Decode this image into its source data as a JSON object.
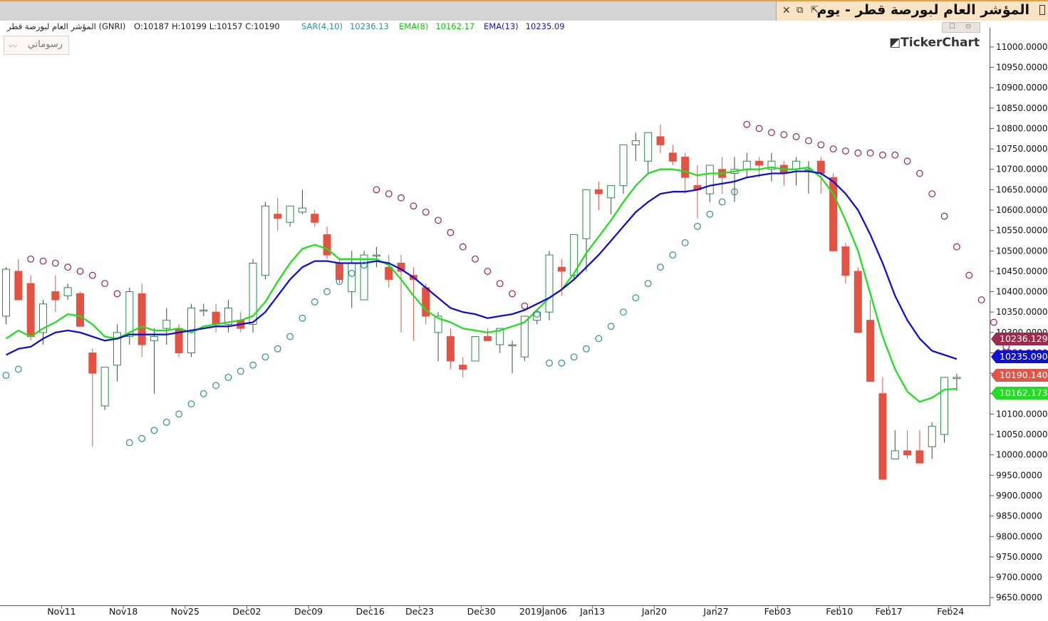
{
  "window": {
    "title": "المؤشر العام لبورصة قطر - يوم",
    "close_icon": "close-icon",
    "restore_icon": "restore-icon",
    "detach_icon": "detach-icon"
  },
  "header": {
    "symbol": "المؤشر العام لبورصة قطر (GNRI)",
    "ohlc": "O:10187  H:10199  L:10157  C:10190",
    "indicators": [
      {
        "label": "SAR(4,10)",
        "value": "10236.13",
        "color": "#2a8f9a"
      },
      {
        "label": "EMA(8)",
        "value": "10162.17",
        "color": "#00e000"
      },
      {
        "label": "EMA(13)",
        "value": "10235.09",
        "color": "#1515c8"
      }
    ]
  },
  "toolbar": {
    "drawing_label": "رسوماتي",
    "drawing_icon": "line-chart-icon"
  },
  "watermark": "TickerChart",
  "chart_data": {
    "type": "candlestick",
    "ylim": [
      9630,
      11020
    ],
    "y_ticks": [
      11000,
      10950,
      10900,
      10850,
      10800,
      10750,
      10700,
      10650,
      10600,
      10550,
      10500,
      10450,
      10400,
      10350,
      10300,
      10250,
      10200,
      10150,
      10100,
      10050,
      10000,
      9950,
      9900,
      9850,
      9800,
      9750,
      9700,
      9650
    ],
    "y_tick_labels": [
      "11000.0000",
      "10950.0000",
      "10900.0000",
      "10850.0000",
      "10800.0000",
      "10750.0000",
      "10700.0000",
      "10650.0000",
      "10600.0000",
      "10550.0000",
      "10500.0000",
      "10450.0000",
      "10400.0000",
      "10350.0000",
      "10300.0000",
      "10250.0000",
      "10200.0000",
      "10150.0000",
      "10100.0000",
      "10050.0000",
      "10000.0000",
      "9950.0000",
      "9900.0000",
      "9850.0000",
      "9800.0000",
      "9750.0000",
      "9700.0000",
      "9650.0000"
    ],
    "x_labels": [
      {
        "label": "Nov11",
        "index": 4.5
      },
      {
        "label": "Nov18",
        "index": 9.5
      },
      {
        "label": "Nov25",
        "index": 14.5
      },
      {
        "label": "Dec02",
        "index": 19.5
      },
      {
        "label": "Dec09",
        "index": 24.5
      },
      {
        "label": "Dec16",
        "index": 29.5
      },
      {
        "label": "Dec23",
        "index": 33.5
      },
      {
        "label": "Dec30",
        "index": 38.5
      },
      {
        "label": "2019Jan06",
        "index": 43.5
      },
      {
        "label": "Jan13",
        "index": 47.5
      },
      {
        "label": "Jan20",
        "index": 52.5
      },
      {
        "label": "Jan27",
        "index": 57.5
      },
      {
        "label": "Feb03",
        "index": 62.5
      },
      {
        "label": "Feb10",
        "index": 67.5
      },
      {
        "label": "Feb17",
        "index": 71.5
      },
      {
        "label": "Feb24",
        "index": 76.5
      }
    ],
    "candles": [
      [
        10340,
        10460,
        10320,
        10455
      ],
      [
        10450,
        10480,
        10400,
        10380
      ],
      [
        10420,
        10440,
        10280,
        10290
      ],
      [
        10300,
        10380,
        10270,
        10370
      ],
      [
        10400,
        10440,
        10350,
        10380
      ],
      [
        10390,
        10420,
        10380,
        10410
      ],
      [
        10395,
        10400,
        10320,
        10315
      ],
      [
        10250,
        10260,
        10020,
        10200
      ],
      [
        10120,
        10210,
        10110,
        10215
      ],
      [
        10220,
        10320,
        10180,
        10300
      ],
      [
        10290,
        10410,
        10270,
        10400
      ],
      [
        10395,
        10420,
        10240,
        10270
      ],
      [
        10280,
        10310,
        10150,
        10290
      ],
      [
        10310,
        10360,
        10270,
        10330
      ],
      [
        10310,
        10320,
        10240,
        10250
      ],
      [
        10250,
        10370,
        10240,
        10360
      ],
      [
        10355,
        10370,
        10340,
        10355
      ],
      [
        10350,
        10370,
        10300,
        10320
      ],
      [
        10320,
        10380,
        10300,
        10360
      ],
      [
        10330,
        10350,
        10300,
        10310
      ],
      [
        10320,
        10480,
        10300,
        10470
      ],
      [
        10440,
        10620,
        10430,
        10610
      ],
      [
        10590,
        10630,
        10550,
        10580
      ],
      [
        10570,
        10610,
        10560,
        10610
      ],
      [
        10595,
        10650,
        10590,
        10605
      ],
      [
        10590,
        10600,
        10560,
        10570
      ],
      [
        10540,
        10560,
        10480,
        10490
      ],
      [
        10470,
        10480,
        10420,
        10430
      ],
      [
        10400,
        10500,
        10360,
        10470
      ],
      [
        10380,
        10500,
        10380,
        10490
      ],
      [
        10490,
        10510,
        10460,
        10490
      ],
      [
        10460,
        10490,
        10410,
        10430
      ],
      [
        10470,
        10490,
        10300,
        10450
      ],
      [
        10440,
        10460,
        10280,
        10430
      ],
      [
        10410,
        10420,
        10320,
        10340
      ],
      [
        10300,
        10350,
        10230,
        10340
      ],
      [
        10290,
        10310,
        10210,
        10230
      ],
      [
        10220,
        10240,
        10190,
        10210
      ],
      [
        10230,
        10290,
        10230,
        10290
      ],
      [
        10290,
        10310,
        10280,
        10280
      ],
      [
        10270,
        10310,
        10250,
        10310
      ],
      [
        10270,
        10280,
        10200,
        10270
      ],
      [
        10240,
        10340,
        10230,
        10340
      ],
      [
        10330,
        10350,
        10320,
        10350
      ],
      [
        10350,
        10500,
        10330,
        10490
      ],
      [
        10460,
        10480,
        10390,
        10450
      ],
      [
        10440,
        10530,
        10430,
        10540
      ],
      [
        10530,
        10560,
        10450,
        10650
      ],
      [
        10650,
        10670,
        10600,
        10640
      ],
      [
        10630,
        10650,
        10590,
        10660
      ],
      [
        10660,
        10700,
        10640,
        10760
      ],
      [
        10760,
        10790,
        10720,
        10770
      ],
      [
        10720,
        10790,
        10690,
        10790
      ],
      [
        10780,
        10810,
        10740,
        10760
      ],
      [
        10740,
        10760,
        10710,
        10720
      ],
      [
        10730,
        10740,
        10640,
        10680
      ],
      [
        10660,
        10710,
        10580,
        10650
      ],
      [
        10640,
        10710,
        10620,
        10710
      ],
      [
        10700,
        10730,
        10640,
        10680
      ],
      [
        10690,
        10730,
        10620,
        10700
      ],
      [
        10700,
        10740,
        10680,
        10720
      ],
      [
        10720,
        10730,
        10680,
        10710
      ],
      [
        10700,
        10740,
        10670,
        10720
      ],
      [
        10710,
        10720,
        10660,
        10690
      ],
      [
        10700,
        10730,
        10660,
        10720
      ],
      [
        10700,
        10720,
        10640,
        10700
      ],
      [
        10720,
        10730,
        10640,
        10690
      ],
      [
        10680,
        10690,
        10500,
        10500
      ],
      [
        10510,
        10520,
        10420,
        10440
      ],
      [
        10450,
        10460,
        10300,
        10300
      ],
      [
        10330,
        10380,
        10180,
        10180
      ],
      [
        10150,
        10190,
        9940,
        9940
      ],
      [
        9990,
        10060,
        9990,
        10010
      ],
      [
        10010,
        10060,
        9990,
        10000
      ],
      [
        10010,
        10060,
        9980,
        9980
      ],
      [
        10020,
        10080,
        9990,
        10070
      ],
      [
        10050,
        10190,
        10030,
        10190
      ],
      [
        10187,
        10199,
        10157,
        10190
      ]
    ],
    "series": [
      {
        "name": "SAR(4,10)",
        "last": "10236.1298",
        "color_rising": "#2a8f9a",
        "color_falling": "#9a2050",
        "values": [
          10195,
          10210,
          10480,
          10475,
          10470,
          10460,
          10450,
          10440,
          10420,
          10395,
          10030,
          10040,
          10060,
          10080,
          10100,
          10125,
          10150,
          10170,
          10190,
          10205,
          10220,
          10240,
          10260,
          10290,
          10335,
          10375,
          10400,
          10425,
          10445,
          10465,
          10650,
          10640,
          10630,
          10610,
          10595,
          10575,
          10545,
          10510,
          10480,
          10450,
          10420,
          10395,
          10365,
          10345,
          10225,
          10225,
          10240,
          10260,
          10285,
          10315,
          10350,
          10385,
          10420,
          10460,
          10490,
          10520,
          10560,
          10590,
          10620,
          10645,
          10810,
          10800,
          10790,
          10785,
          10780,
          10770,
          10760,
          10750,
          10745,
          10740,
          10740,
          10735,
          10735,
          10720,
          10690,
          10640,
          10585,
          10510,
          10440,
          10380,
          10325,
          10265,
          10236
        ]
      },
      {
        "name": "EMA(8)",
        "last": "10162.1738",
        "color": "#1fe01f",
        "values": [
          10285,
          10305,
          10290,
          10310,
          10325,
          10345,
          10340,
          10320,
          10290,
          10285,
          10300,
          10315,
          10305,
          10305,
          10310,
          10300,
          10315,
          10320,
          10325,
          10330,
          10340,
          10375,
          10425,
          10470,
          10505,
          10515,
          10505,
          10480,
          10480,
          10480,
          10480,
          10465,
          10430,
          10390,
          10355,
          10335,
          10325,
          10310,
          10305,
          10300,
          10305,
          10315,
          10325,
          10355,
          10385,
          10405,
          10445,
          10495,
          10535,
          10575,
          10620,
          10660,
          10690,
          10700,
          10700,
          10695,
          10685,
          10690,
          10690,
          10695,
          10700,
          10700,
          10705,
          10700,
          10700,
          10705,
          10680,
          10640,
          10575,
          10500,
          10395,
          10290,
          10210,
          10155,
          10130,
          10140,
          10160,
          10162
        ]
      },
      {
        "name": "EMA(13)",
        "last": "10235.0905",
        "color": "#1010d0",
        "values": [
          10245,
          10260,
          10265,
          10285,
          10300,
          10305,
          10300,
          10290,
          10280,
          10285,
          10295,
          10295,
          10295,
          10295,
          10300,
          10305,
          10310,
          10315,
          10315,
          10320,
          10325,
          10350,
          10390,
          10430,
          10460,
          10475,
          10475,
          10470,
          10470,
          10470,
          10475,
          10470,
          10455,
          10435,
          10410,
          10385,
          10360,
          10350,
          10345,
          10335,
          10340,
          10345,
          10355,
          10370,
          10385,
          10405,
          10430,
          10460,
          10490,
          10525,
          10560,
          10595,
          10620,
          10640,
          10645,
          10645,
          10650,
          10660,
          10665,
          10670,
          10680,
          10685,
          10690,
          10690,
          10695,
          10695,
          10690,
          10670,
          10640,
          10600,
          10540,
          10470,
          10390,
          10330,
          10285,
          10255,
          10245,
          10235
        ]
      }
    ],
    "price_labels": [
      {
        "value": "10236.1298",
        "color": "#9b2c4d"
      },
      {
        "value": "10235.0905",
        "color": "#1010d0"
      },
      {
        "value": "10190.1406",
        "color": "#e05545"
      },
      {
        "value": "10162.1738",
        "color": "#22dd22"
      }
    ],
    "colors": {
      "up_body": "#ffffff",
      "up_border": "#2a8a4a",
      "down": "#e25343",
      "grid": "#dddddd",
      "axis": "#555555",
      "up_filled": "#3e9a6a"
    }
  }
}
